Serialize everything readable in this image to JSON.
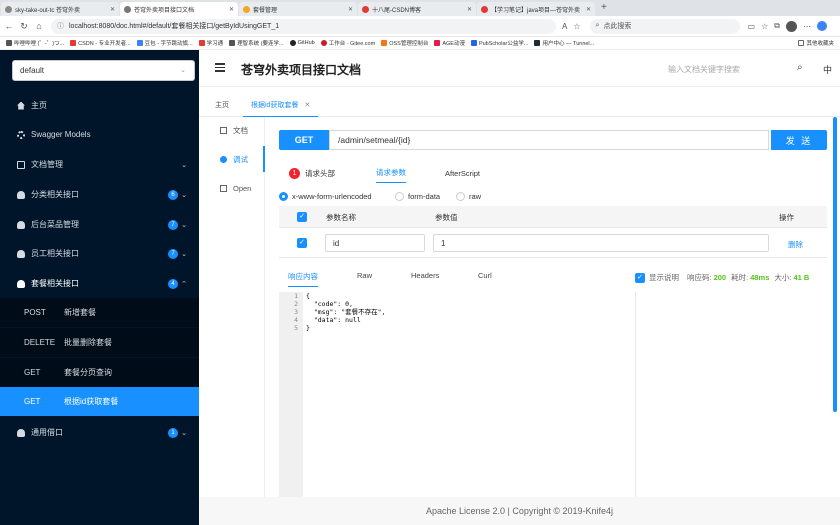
{
  "browser": {
    "tabs": [
      {
        "title": "sky-take-out-tc 苍穹外卖",
        "color": "#666"
      },
      {
        "title": "苍穹外卖项目接口文档",
        "color": "#666"
      },
      {
        "title": "套餐管理",
        "color": "#f5a623"
      },
      {
        "title": "十八尾-CSDN博客",
        "color": "#e53935"
      },
      {
        "title": "【学习笔记】java项目—苍穹外卖",
        "color": "#e53935"
      }
    ],
    "url": "localhost:8080/doc.html#/default/套餐相关接口/getByIdUsingGET_1",
    "search_placeholder": "点此搜索",
    "bookmarks": [
      "哔哩哔哩 (゜-゜)つ...",
      "CSDN - 专业开发者...",
      "豆包 - 字节跳动旗...",
      "学习通",
      "理智系统 (要连学...",
      "GitHub",
      "工作台 - Gitee.com",
      "OSS管理控制台",
      "AGE动漫",
      "PubScholar公益学...",
      "用户中心 — Tunnel...",
      "其他收藏夹"
    ]
  },
  "header": {
    "title": "苍穹外卖项目接口文档",
    "search_placeholder": "输入文档关键字搜索",
    "lang": "中"
  },
  "sidebar": {
    "group": "default",
    "items": [
      {
        "label": "主页"
      },
      {
        "label": "Swagger Models"
      },
      {
        "label": "文档管理"
      },
      {
        "label": "分类相关接口",
        "badge": "6"
      },
      {
        "label": "后台菜品管理",
        "badge": "7"
      },
      {
        "label": "员工相关接口",
        "badge": "7"
      },
      {
        "label": "套餐相关接口",
        "badge": "4"
      },
      {
        "label": "通用借口",
        "badge": "1"
      }
    ],
    "subs": [
      {
        "method": "POST",
        "label": "新增套餐"
      },
      {
        "method": "DELETE",
        "label": "批量删除套餐"
      },
      {
        "method": "GET",
        "label": "套餐分页查询"
      },
      {
        "method": "GET",
        "label": "根据id获取套餐"
      }
    ]
  },
  "page_tabs": [
    "主页",
    "根据id获取套餐"
  ],
  "left_nav": [
    "文档",
    "调试",
    "Open"
  ],
  "request": {
    "method": "GET",
    "path": "/admin/setmeal/{id}",
    "send": "发 送",
    "tabs": [
      "请求头部",
      "请求参数",
      "AfterScript"
    ],
    "header_badge": "1",
    "body_types": [
      "x-www-form-urlencoded",
      "form-data",
      "raw"
    ],
    "col_name": "参数名称",
    "col_value": "参数值",
    "col_action": "操作",
    "param_name": "id",
    "param_value": "1",
    "delete": "删除"
  },
  "response": {
    "tabs": [
      "响应内容",
      "Raw",
      "Headers",
      "Curl"
    ],
    "show_label": "显示说明",
    "code_label": "响应码:",
    "code": "200",
    "time_label": "耗时:",
    "time": "48ms",
    "size_label": "大小:",
    "size": "41 B",
    "lines": [
      "{",
      "  \"code\": 0,",
      "  \"msg\": \"套餐不存在\",",
      "  \"data\": null",
      "}"
    ],
    "line_numbers": [
      "1",
      "2",
      "3",
      "4",
      "5"
    ]
  },
  "footer": "Apache License 2.0 | Copyright © 2019-Knife4j",
  "colors": {
    "accent": "#1890ff",
    "sidebar": "#001529",
    "error": "#f5222d",
    "success": "#52c41a"
  }
}
